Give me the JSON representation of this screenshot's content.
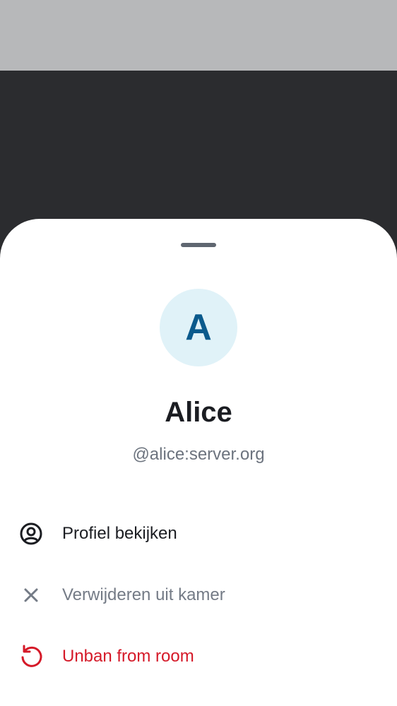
{
  "user": {
    "avatar_initial": "A",
    "display_name": "Alice",
    "user_id": "@alice:server.org"
  },
  "menu": {
    "items": [
      {
        "label": "Profiel bekijken",
        "icon": "user-profile-icon",
        "color": "#1b1d22"
      },
      {
        "label": "Verwijderen uit kamer",
        "icon": "close-icon",
        "color": "#747b86"
      },
      {
        "label": "Unban from room",
        "icon": "restore-icon",
        "color": "#d51928"
      }
    ]
  },
  "colors": {
    "sheet_background": "#ffffff",
    "scrim": "#2b2c2f",
    "avatar_background": "#e0f2f8",
    "avatar_text": "#0a5a8c",
    "critical": "#d51928"
  }
}
